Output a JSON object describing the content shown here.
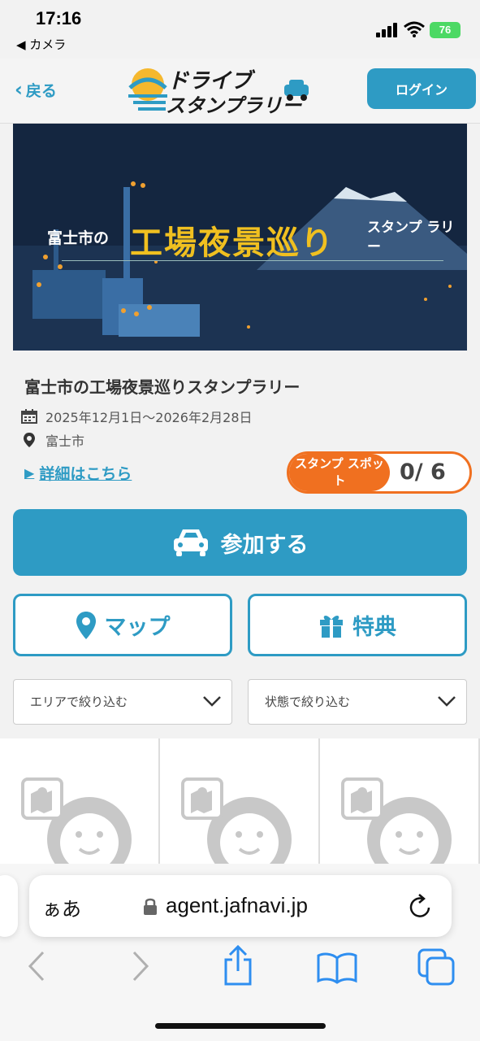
{
  "status_bar": {
    "time": "17:16",
    "back_app": "◀ カメラ",
    "battery": "76"
  },
  "header": {
    "back_label": "戻る",
    "logo_line1": "ドライブ",
    "logo_line2": "スタンプラリー",
    "login_label": "ログイン"
  },
  "banner": {
    "pre_text": "富士市の",
    "main_text": "工場夜景巡り",
    "post_text": "スタンプ ラリー"
  },
  "event": {
    "title": "富士市の工場夜景巡りスタンプラリー",
    "date": "2025年12月1日〜2026年2月28日",
    "place": "富士市",
    "details_link": "詳細はこちら",
    "stamp_label": "スタンプ スポット",
    "stamp_count": "0/ 6"
  },
  "actions": {
    "join_label": "参加する",
    "map_label": "マップ",
    "benefit_label": "特典"
  },
  "filters": {
    "area_label": "エリアで絞り込む",
    "state_label": "状態で絞り込む"
  },
  "safari": {
    "aa_label": "ぁあ",
    "url": "agent.jafnavi.jp"
  },
  "colors": {
    "accent": "#2e9bc4",
    "stamp": "#f07020",
    "banner_bg": "#122238"
  }
}
